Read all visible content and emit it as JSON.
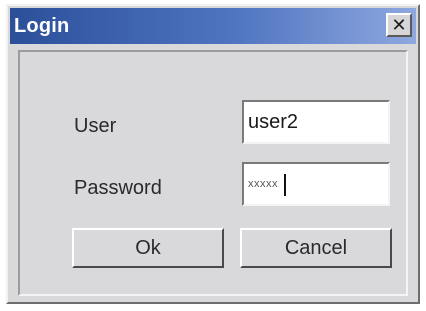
{
  "window": {
    "title": "Login",
    "close_label": "✕"
  },
  "form": {
    "user_label": "User",
    "user_value": "user2",
    "password_label": "Password",
    "password_masked": "xxxxx"
  },
  "buttons": {
    "ok_label": "Ok",
    "cancel_label": "Cancel"
  },
  "colors": {
    "titlebar_start": "#2c4f9a",
    "titlebar_end": "#8ea8df",
    "dialog_face": "#d9d9dc"
  }
}
